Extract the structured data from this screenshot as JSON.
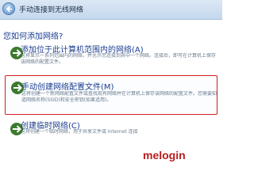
{
  "window": {
    "title": "手动连接到无线网络"
  },
  "heading": "您如何添加网络?",
  "options": [
    {
      "title": "添加位于此计算机范围内的网络(A)",
      "desc": "这将显示一系列范围内的网络，并允许您连接到其中一个网络。连接后，即可在计算机上保存该网络的配置文件。"
    },
    {
      "title": "手动创建网络配置文件(M)",
      "desc": "这将创建一个新网络配置文件或查找现有网络并在计算机上保存该网络的配置文件。您需要知道网络名称(SSID)和安全密钥(如果适用)。"
    },
    {
      "title": "创建临时网络(C)",
      "desc": "这将创建一个临时网络，用于共享文件或 Internet 连接"
    }
  ],
  "watermark": "melogin",
  "colors": {
    "accent": "#1a3d8f",
    "selection_border": "#d02020"
  }
}
